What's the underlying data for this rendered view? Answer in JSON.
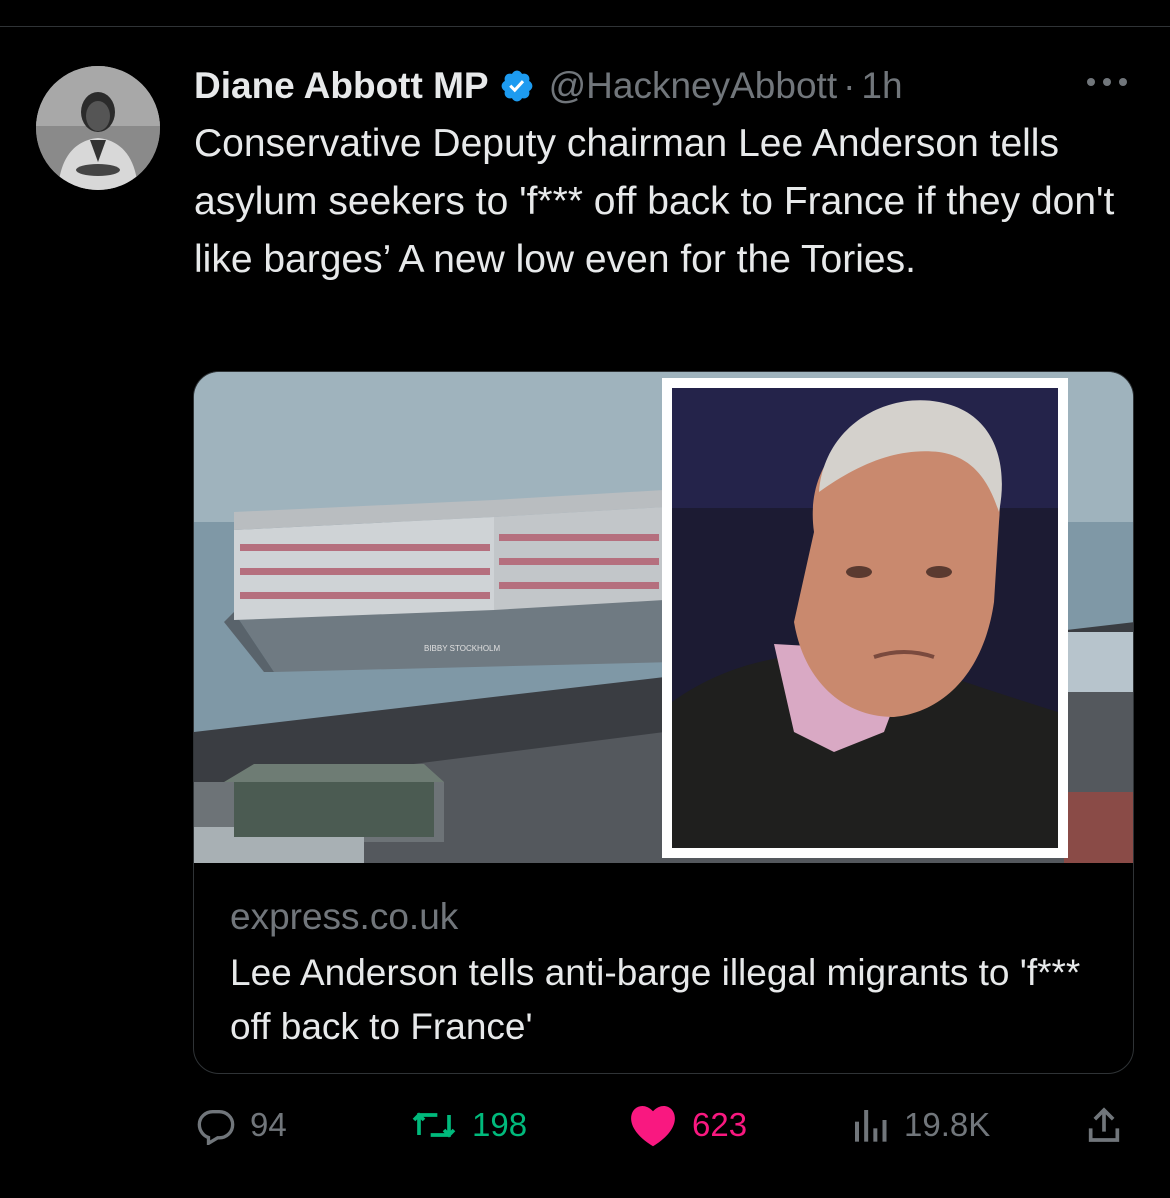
{
  "tweet": {
    "author": {
      "display_name": "Diane Abbott MP",
      "handle": "@HackneyAbbott",
      "verified": true
    },
    "separator": "·",
    "time": "1h",
    "text": "Conservative Deputy chairman Lee Anderson tells asylum seekers to 'f*** off back to France if they don't like barges’ A new low even for the Tories."
  },
  "link_card": {
    "domain": "express.co.uk",
    "title": "Lee Anderson tells anti-barge illegal migrants to 'f*** off back to France'",
    "image_barge_label": "BIBBY STOCKHOLM"
  },
  "actions": {
    "replies": "94",
    "retweets": "198",
    "likes": "623",
    "views": "19.8K"
  },
  "icons": [
    "verified-badge-icon",
    "more-icon",
    "reply-icon",
    "retweet-icon",
    "like-icon",
    "views-icon",
    "share-icon"
  ],
  "colors": {
    "background": "#000000",
    "text": "#e7e9ea",
    "muted": "#71767b",
    "retweet": "#00ba7c",
    "like": "#f91880",
    "verified": "#1d9bf0"
  }
}
